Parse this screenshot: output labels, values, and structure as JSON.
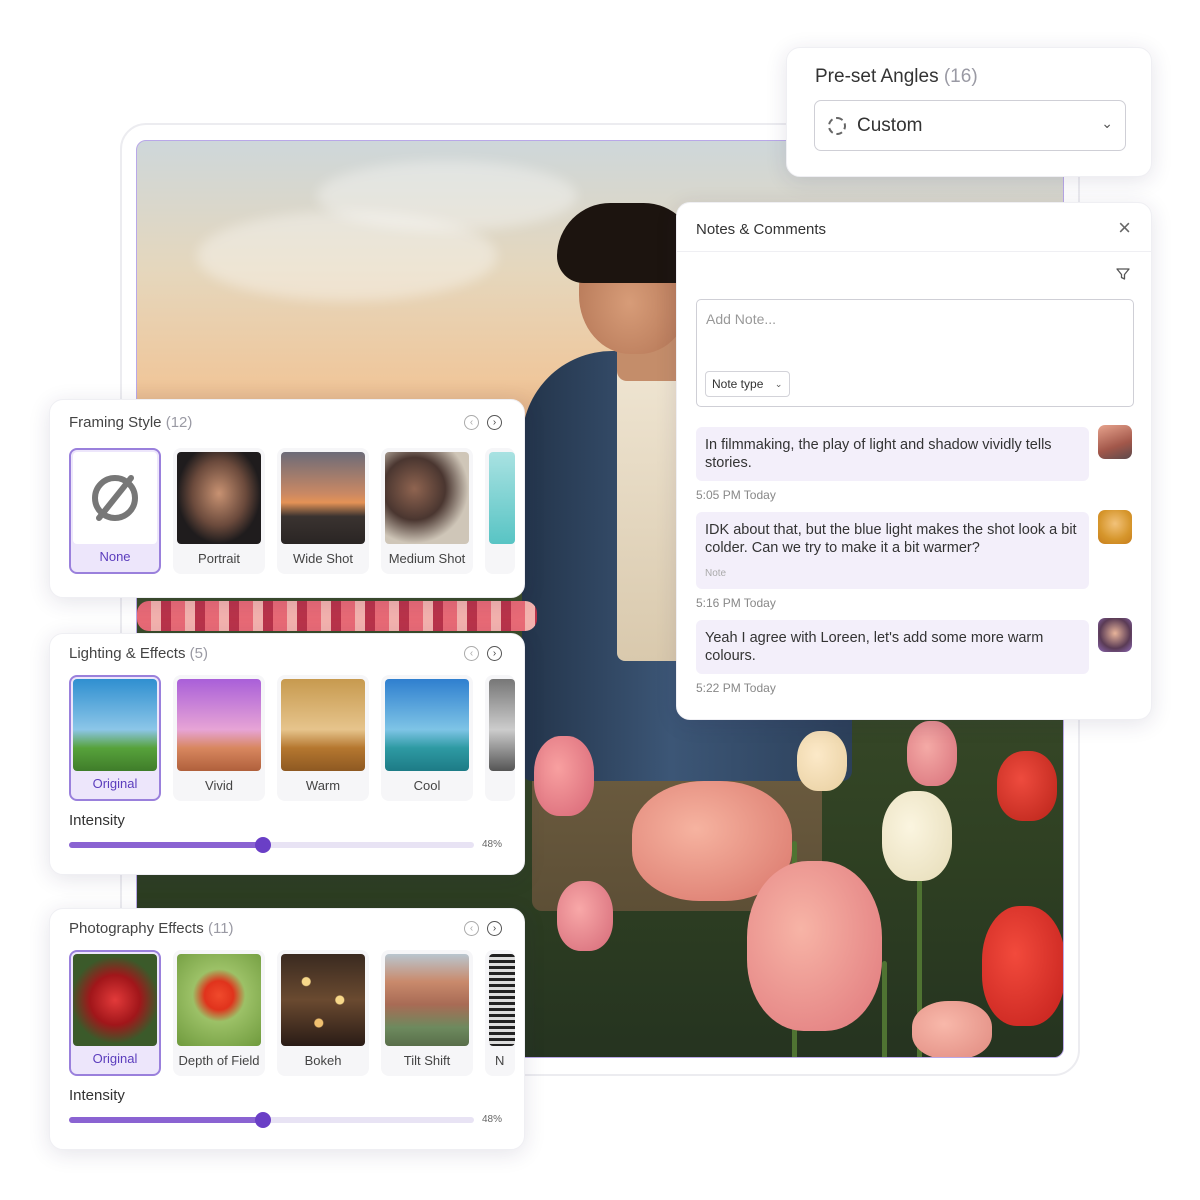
{
  "preset_angles": {
    "title": "Pre-set Angles",
    "count": "(16)",
    "selected": "Custom",
    "chevron_icon": "chevron-down-icon"
  },
  "notes": {
    "title": "Notes & Comments",
    "close_glyph": "×",
    "input_placeholder": "Add Note...",
    "note_type_label": "Note type",
    "comments": [
      {
        "text": "In filmmaking, the play of light and shadow vividly tells stories.",
        "tag": "",
        "time": "5:05 PM Today"
      },
      {
        "text": "IDK about that, but the blue light makes the shot look a bit colder. Can we try to make it a bit warmer?",
        "tag": "Note",
        "time": "5:16 PM Today"
      },
      {
        "text": "Yeah I agree with Loreen, let's add some more warm colours.",
        "tag": "",
        "time": "5:22 PM Today"
      }
    ]
  },
  "framing": {
    "title": "Framing Style",
    "count": "(12)",
    "items": [
      {
        "label": "None",
        "selected": true
      },
      {
        "label": "Portrait",
        "selected": false
      },
      {
        "label": "Wide Shot",
        "selected": false
      },
      {
        "label": "Medium Shot",
        "selected": false
      }
    ]
  },
  "lighting": {
    "title": "Lighting & Effects",
    "count": "(5)",
    "items": [
      {
        "label": "Original",
        "selected": true
      },
      {
        "label": "Vivid",
        "selected": false
      },
      {
        "label": "Warm",
        "selected": false
      },
      {
        "label": "Cool",
        "selected": false
      }
    ],
    "intensity_label": "Intensity",
    "intensity_value": 0.48,
    "intensity_text": "48%"
  },
  "photography": {
    "title": "Photography Effects",
    "count": "(11)",
    "items": [
      {
        "label": "Original",
        "selected": true
      },
      {
        "label": "Depth of Field",
        "selected": false
      },
      {
        "label": "Bokeh",
        "selected": false
      },
      {
        "label": "Tilt Shift",
        "selected": false
      }
    ],
    "cut_label": "N",
    "intensity_label": "Intensity",
    "intensity_value": 0.48,
    "intensity_text": "48%"
  },
  "colors": {
    "accent": "#6a3fc6",
    "accent_fill": "#8a63d2",
    "selected_bg": "#ede6fb",
    "comment_bg": "#f3effa"
  }
}
